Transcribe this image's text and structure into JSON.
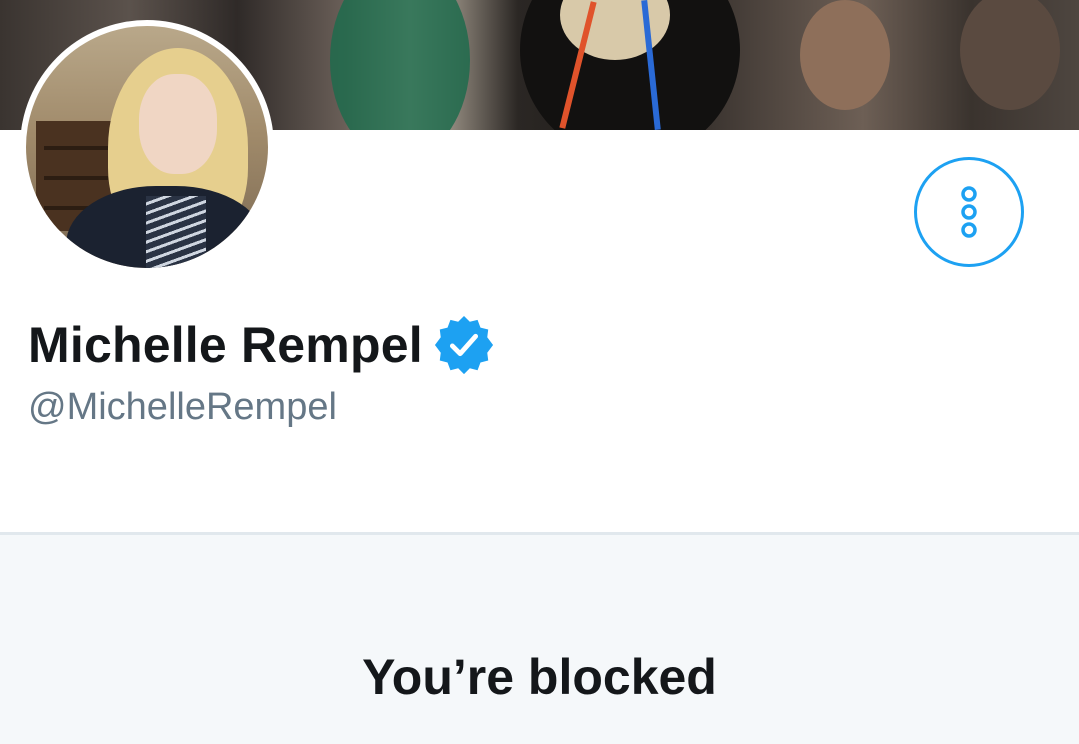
{
  "profile": {
    "display_name": "Michelle Rempel",
    "handle": "@MichelleRempel",
    "verified": true
  },
  "icons": {
    "more": "more-vertical-icon",
    "verified": "verified-badge-icon"
  },
  "blocked": {
    "title": "You’re blocked"
  },
  "colors": {
    "accent": "#1da1f2",
    "text_primary": "#14171a",
    "text_secondary": "#657786",
    "blocked_bg": "#f5f8fa"
  }
}
